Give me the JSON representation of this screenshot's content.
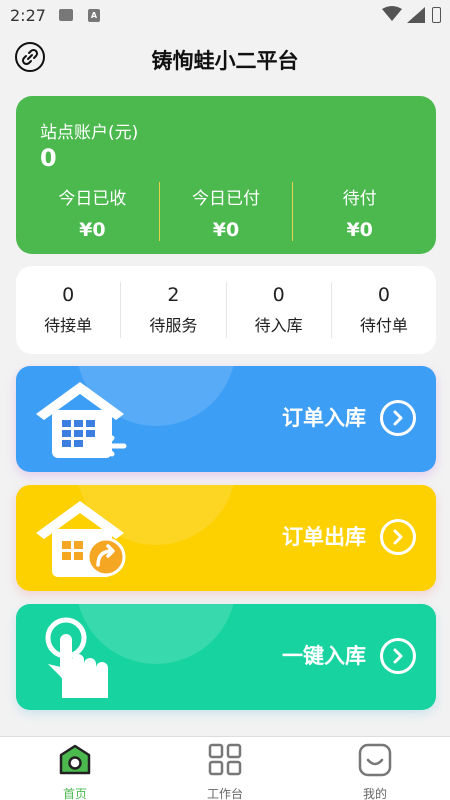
{
  "status_bar": {
    "time": "2:27",
    "notif_text": "A"
  },
  "header": {
    "title": "铸恂蛙小二平台"
  },
  "account": {
    "label": "站点账户(元)",
    "amount": "0",
    "columns": [
      {
        "label": "今日已收",
        "value": "¥0"
      },
      {
        "label": "今日已付",
        "value": "¥0"
      },
      {
        "label": "待付",
        "value": "¥0"
      }
    ]
  },
  "stats": [
    {
      "count": "0",
      "label": "待接单"
    },
    {
      "count": "2",
      "label": "待服务"
    },
    {
      "count": "0",
      "label": "待入库"
    },
    {
      "count": "0",
      "label": "待付单"
    }
  ],
  "actions": [
    {
      "label": "订单入库",
      "icon": "house-arrow-in-icon",
      "color": "#3d9ef5"
    },
    {
      "label": "订单出库",
      "icon": "house-share-icon",
      "color": "#fdd000"
    },
    {
      "label": "一键入库",
      "icon": "tap-hand-icon",
      "color": "#17d3a0"
    }
  ],
  "tabbar": [
    {
      "label": "首页",
      "icon": "home-icon",
      "active": true
    },
    {
      "label": "工作台",
      "icon": "grid-icon",
      "active": false
    },
    {
      "label": "我的",
      "icon": "smile-icon",
      "active": false
    }
  ],
  "colors": {
    "accent": "#4cb94f",
    "background": "#f2f2f2"
  }
}
